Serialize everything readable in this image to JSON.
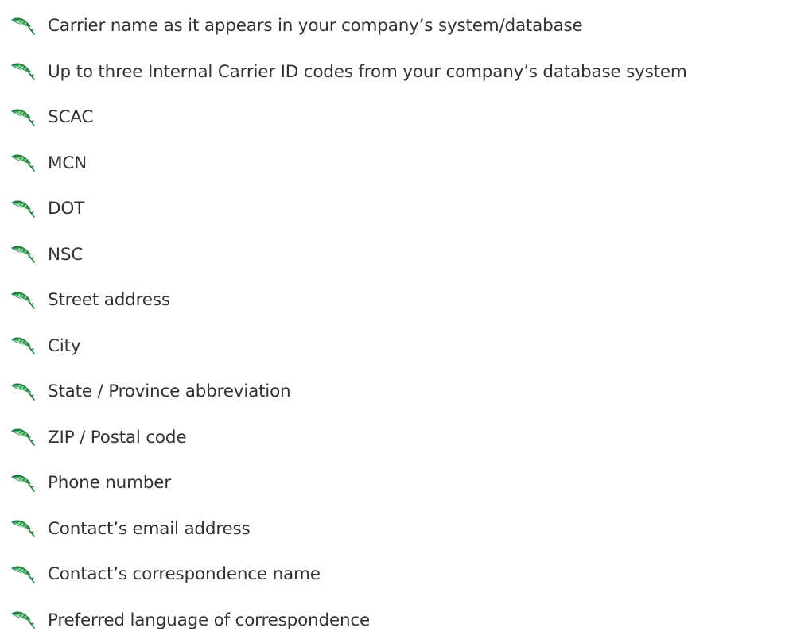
{
  "colors": {
    "text": "#333333",
    "icon_dark": "#1f7a3a",
    "icon_mid": "#39a85a",
    "icon_light": "#cfe9d6"
  },
  "bullet_icon": "green-feather-leaf-icon",
  "items": [
    {
      "label": "Carrier name as it appears in your company’s system/database"
    },
    {
      "label": "Up to three Internal Carrier ID codes from your company’s database system"
    },
    {
      "label": "SCAC"
    },
    {
      "label": "MCN"
    },
    {
      "label": "DOT"
    },
    {
      "label": "NSC"
    },
    {
      "label": "Street address"
    },
    {
      "label": "City"
    },
    {
      "label": "State / Province abbreviation"
    },
    {
      "label": "ZIP / Postal code"
    },
    {
      "label": "Phone number"
    },
    {
      "label": "Contact’s email address"
    },
    {
      "label": "Contact’s correspondence name"
    },
    {
      "label": "Preferred language of correspondence"
    }
  ]
}
